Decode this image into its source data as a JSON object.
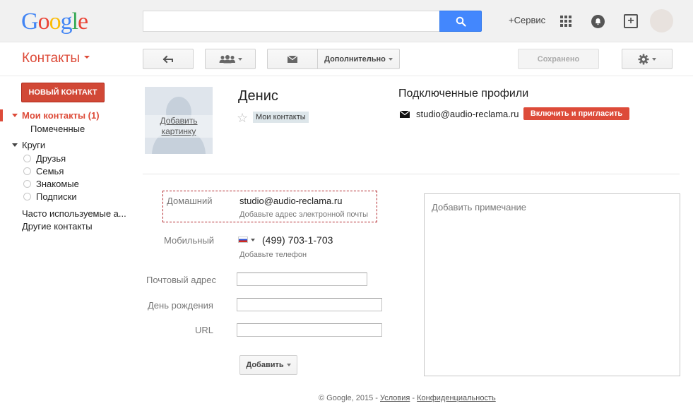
{
  "header": {
    "logo": [
      "G",
      "o",
      "o",
      "g",
      "l",
      "e"
    ],
    "logo_colors": [
      "#4285f4",
      "#ea4335",
      "#fbbc05",
      "#4285f4",
      "#34a853",
      "#ea4335"
    ],
    "search_value": "",
    "plus_service": "+Сервис"
  },
  "toolbar": {
    "app_title": "Контакты",
    "more_label": "Дополнительно",
    "saved_label": "Сохранено"
  },
  "sidebar": {
    "new_contact": "НОВЫЙ КОНТАКТ",
    "my_contacts": "Мои контакты (1)",
    "starred": "Помеченные",
    "circles": "Круги",
    "circle_items": [
      "Друзья",
      "Семья",
      "Знакомые",
      "Подписки"
    ],
    "frequent": "Часто используемые а...",
    "other": "Другие контакты"
  },
  "contact": {
    "photo_label_line1": "Добавить",
    "photo_label_line2": "картинку",
    "name": "Денис",
    "group_badge": "Мои контакты",
    "profiles_title": "Подключенные профили",
    "profile_email": "studio@audio-reclama.ru",
    "invite_button": "Включить и пригласить"
  },
  "form": {
    "home_label": "Домашний",
    "home_email": "studio@audio-reclama.ru",
    "add_email_hint": "Добавьте адрес электронной почты",
    "mobile_label": "Мобильный",
    "phone": "(499) 703-1-703",
    "add_phone_hint": "Добавьте телефон",
    "postal_label": "Почтовый адрес",
    "postal_value": "",
    "birthday_label": "День рождения",
    "birthday_value": "",
    "url_label": "URL",
    "url_value": "",
    "add_button": "Добавить",
    "note_placeholder": "Добавить примечание"
  },
  "footer": {
    "copyright": "© Google, 2015 - ",
    "terms": "Условия",
    "sep": " - ",
    "privacy": "Конфиденциальность"
  },
  "colors": {
    "accent_red": "#dd4b39",
    "search_blue": "#4387fd"
  },
  "icons": {
    "search": "search-icon",
    "back": "back-arrow-icon",
    "people": "people-icon",
    "mail": "mail-icon",
    "gear": "gear-icon",
    "apps": "apps-grid-icon",
    "notifications": "bell-icon",
    "share": "add-share-icon",
    "star": "star-icon"
  }
}
